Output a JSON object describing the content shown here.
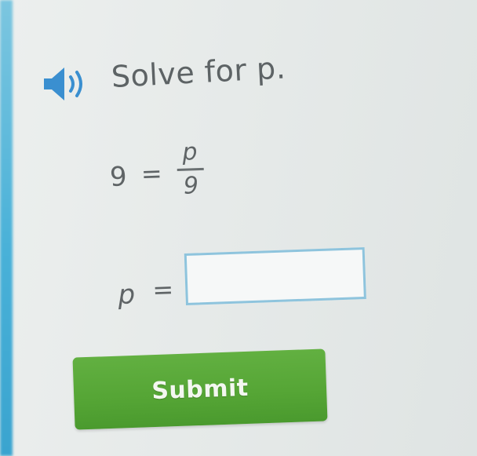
{
  "question": {
    "text": "Solve for p."
  },
  "equation": {
    "lhs": "9",
    "equals": "=",
    "numerator": "p",
    "denominator": "9"
  },
  "answer": {
    "variable": "p",
    "equals": "=",
    "value": "",
    "placeholder": ""
  },
  "submit": {
    "label": "Submit"
  },
  "colors": {
    "submit_bg": "#55a535",
    "input_border": "#8ec4dd",
    "speaker_icon": "#3a8fd0",
    "left_edge": "#49b1d8"
  },
  "icons": {
    "speaker": "speaker-icon"
  }
}
